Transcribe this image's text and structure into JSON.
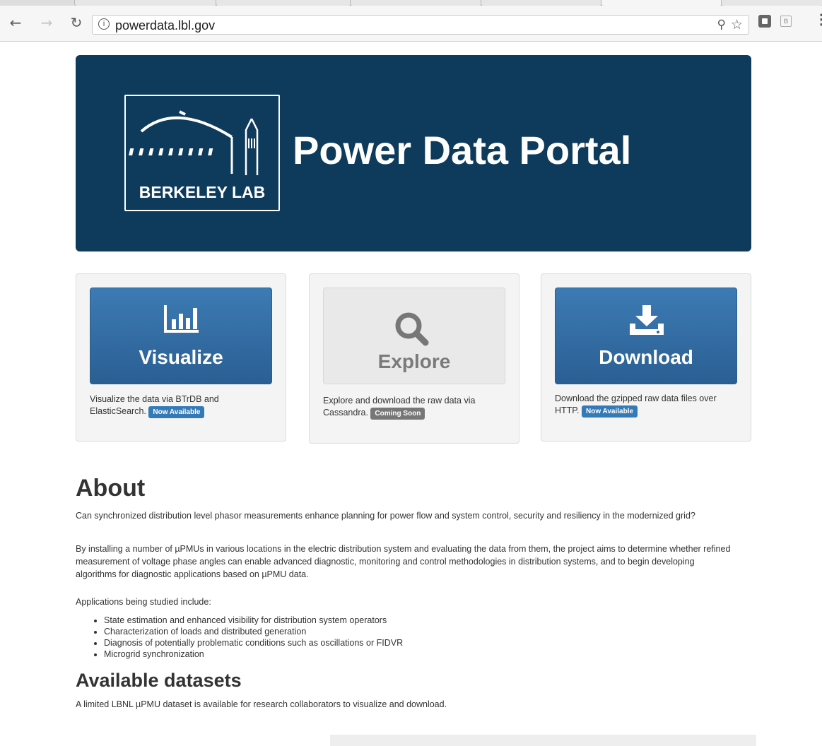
{
  "browser": {
    "url": "powerdata.lbl.gov",
    "back_icon": "arrow-left-icon",
    "forward_icon": "arrow-right-icon",
    "reload_icon": "reload-icon",
    "info_icon": "info-icon",
    "zoom_icon": "zoom-icon",
    "bookmark_icon": "star-icon",
    "menu_icon": "more-vertical-icon"
  },
  "banner": {
    "logo_text": "BERKELEY LAB",
    "title": "Power Data Portal",
    "background": "#0e3b5b"
  },
  "cards": [
    {
      "button_label": "Visualize",
      "icon": "bar-chart-icon",
      "desc": "Visualize the data via BTrDB and ElasticSearch.",
      "badge": "Now Available"
    },
    {
      "button_label": "Explore",
      "icon": "search-icon",
      "desc": "Explore and download the raw data via Cassandra.",
      "badge": "Coming Soon"
    },
    {
      "button_label": "Download",
      "icon": "download-icon",
      "desc": "Download the gzipped raw data files over HTTP.",
      "badge": "Now Available"
    }
  ],
  "about": {
    "heading": "About",
    "p1": "Can synchronized distribution level phasor measurements enhance planning for power flow and system control, security and resiliency in the modernized grid?",
    "p2": "By installing a number of µPMUs in various locations in the electric distribution system and evaluating the data from them, the project aims to determine whether refined measurement of voltage phase angles can enable advanced diagnostic, monitoring and control methodologies in distribution systems, and to begin developing algorithms for diagnostic applications based on µPMU data.",
    "p3": "Applications being studied include:",
    "applications": [
      "State estimation and enhanced visibility for distribution system operators",
      "Characterization of loads and distributed generation",
      "Diagnosis of potentially problematic conditions such as oscillations or FIDVR",
      "Microgrid synchronization"
    ]
  },
  "datasets": {
    "heading": "Available datasets",
    "text": "A limited LBNL µPMU dataset is available for research collaborators to visualize and download."
  },
  "colors": {
    "banner": "#0e3b5b",
    "button_blue": "#2f6aa3",
    "badge_blue": "#337ab7",
    "badge_grey": "#777777"
  }
}
